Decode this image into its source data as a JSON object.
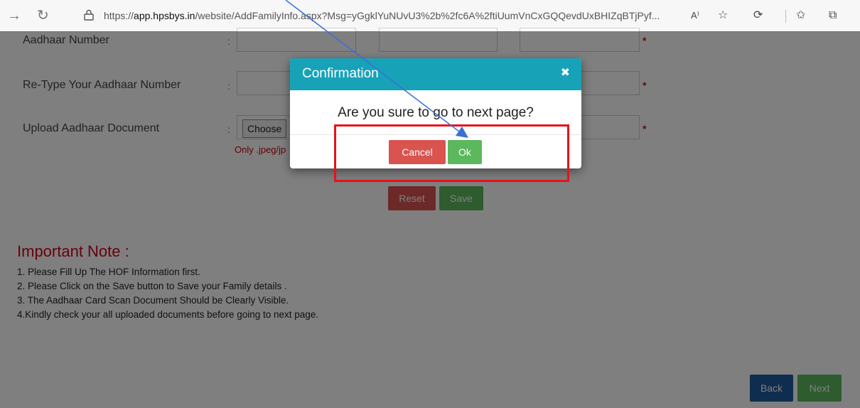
{
  "browser": {
    "back_icon": "back-arrow-icon",
    "refresh_icon": "refresh-icon",
    "lock_icon": "lock-icon",
    "url_prefix": "https://",
    "url_host": "app.hpsbys.in",
    "url_path": "/website/AddFamilyInfo.aspx?Msg=yGgklYuNUvU3%2b%2fc6A%2ftiUumVnCxGQQevdUxBHIZqBTjPyf...",
    "read_aloud_icon": "A⁾",
    "toolbar_icons": [
      "read-aloud-icon",
      "favorite-add-icon",
      "extensions-icon",
      "favorites-icon",
      "collections-icon"
    ]
  },
  "form": {
    "aadhaar_label": "Aadhaar Number",
    "retype_label": "Re-Type Your Aadhaar Number",
    "upload_label": "Upload Aadhaar Document",
    "colon": ":",
    "required_mark": "*",
    "choose_label": "Choose",
    "file_hint": "Only .jpeg/jp",
    "reset_label": "Reset",
    "save_label": "Save"
  },
  "note": {
    "title": "Important Note :",
    "items": [
      "1. Please Fill Up The HOF Information first.",
      "2. Please Click on the Save button to Save your Family details .",
      "3. The Aadhaar Card Scan Document Should be Clearly Visible.",
      "4.Kindly check your all uploaded documents before going to next page."
    ]
  },
  "footer": {
    "back_label": "Back",
    "next_label": "Next"
  },
  "modal": {
    "title": "Confirmation",
    "close_glyph": "✖",
    "message": "Are you sure to go to next page?",
    "cancel_label": "Cancel",
    "ok_label": "Ok"
  },
  "colors": {
    "modal_header": "#17a2b8",
    "cancel": "#d9534f",
    "ok": "#5cb85c",
    "back": "#1f5a9c",
    "annotation": "#e8111a",
    "arrow": "#3b6fd6"
  }
}
